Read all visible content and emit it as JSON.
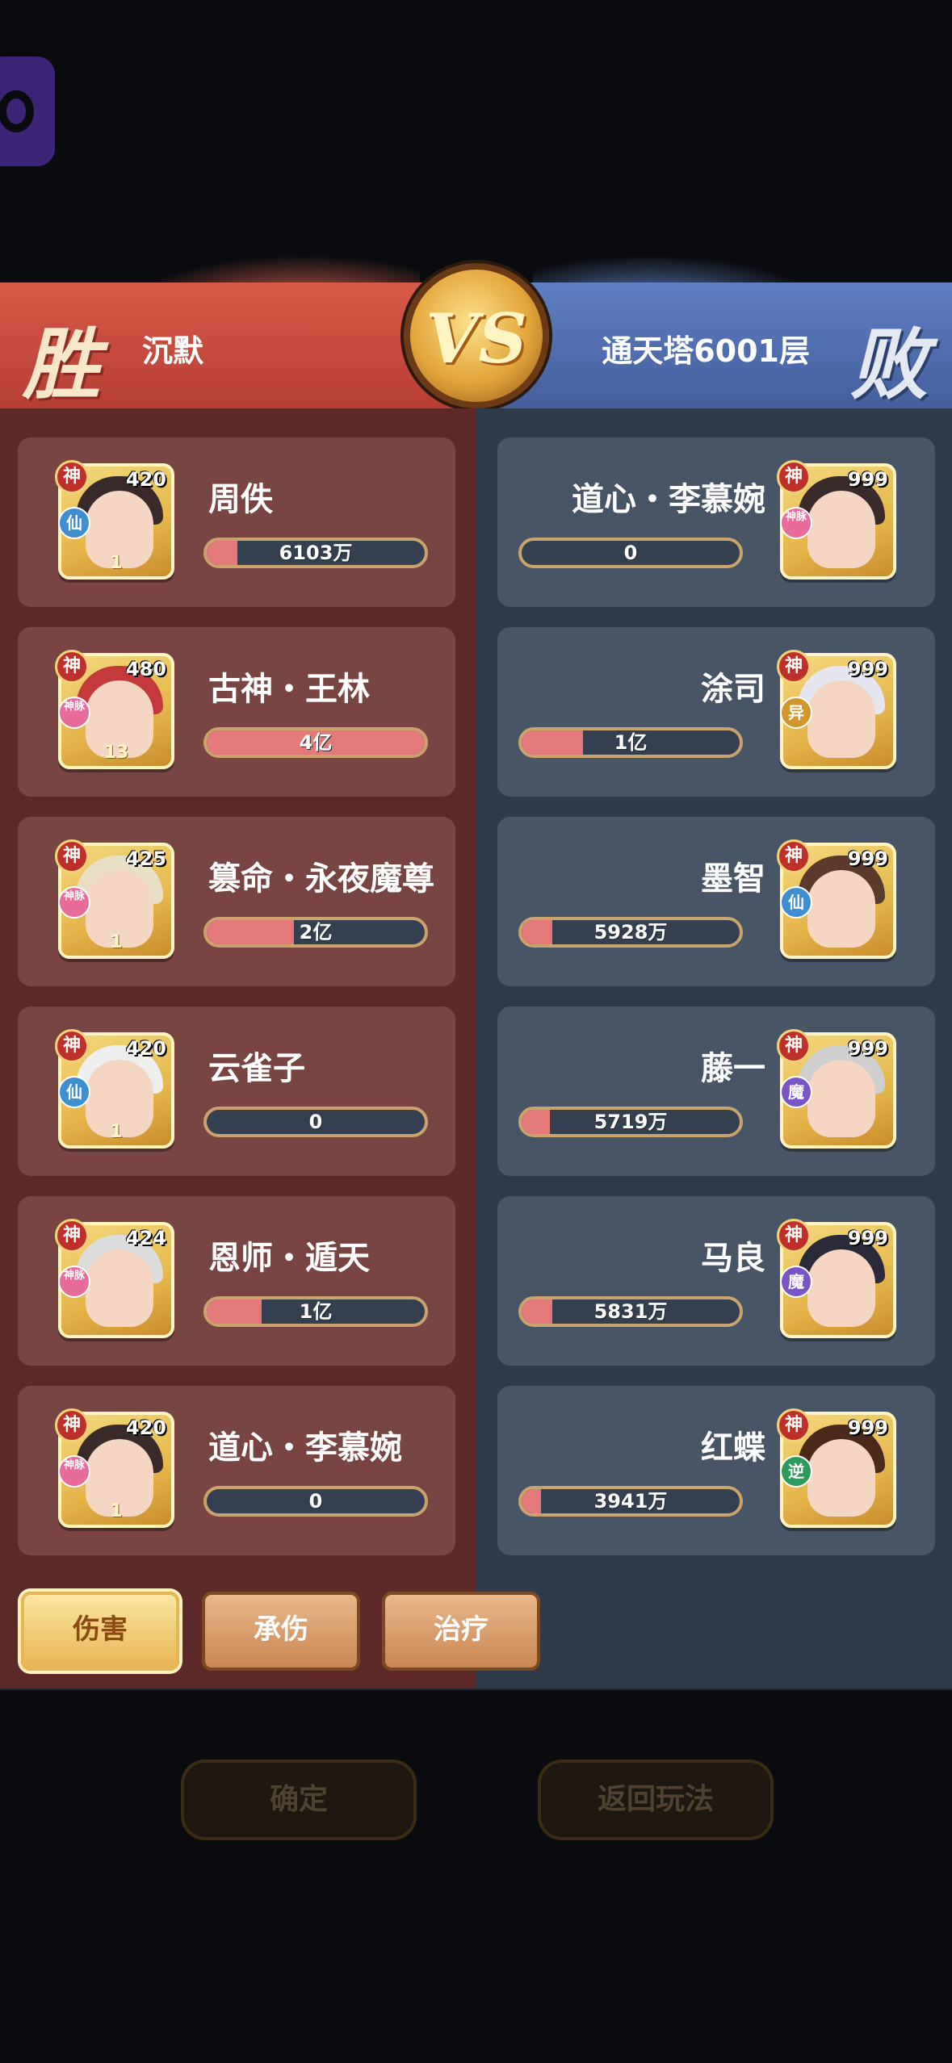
{
  "header": {
    "win_char": "胜",
    "lose_char": "败",
    "vs_label": "VS",
    "left_player": "沉默",
    "right_player": "通天塔6001层"
  },
  "left_team": [
    {
      "name": "周佚",
      "level": "420",
      "god": "神",
      "tag": "仙",
      "stars": "1",
      "value": "6103万",
      "fill": 0.14
    },
    {
      "name": "古神・王林",
      "level": "480",
      "god": "神",
      "tag": "神脉",
      "stars": "13",
      "value": "4亿",
      "fill": 1.0
    },
    {
      "name": "篡命・永夜魔尊",
      "level": "425",
      "god": "神",
      "tag": "神脉",
      "stars": "1",
      "value": "2亿",
      "fill": 0.4
    },
    {
      "name": "云雀子",
      "level": "420",
      "god": "神",
      "tag": "仙",
      "stars": "1",
      "value": "0",
      "fill": 0.0
    },
    {
      "name": "恩师・遁天",
      "level": "424",
      "god": "神",
      "tag": "神脉",
      "stars": "",
      "value": "1亿",
      "fill": 0.25
    },
    {
      "name": "道心・李慕婉",
      "level": "420",
      "god": "神",
      "tag": "神脉",
      "stars": "1",
      "value": "0",
      "fill": 0.0
    }
  ],
  "right_team": [
    {
      "name": "道心・李慕婉",
      "level": "999",
      "god": "神",
      "tag": "神脉",
      "value": "0",
      "fill": 0.0
    },
    {
      "name": "涂司",
      "level": "999",
      "god": "神",
      "tag": "异",
      "value": "1亿",
      "fill": 0.28
    },
    {
      "name": "墨智",
      "level": "999",
      "god": "神",
      "tag": "仙",
      "value": "5928万",
      "fill": 0.14
    },
    {
      "name": "藤一",
      "level": "999",
      "god": "神",
      "tag": "魔",
      "value": "5719万",
      "fill": 0.13
    },
    {
      "name": "马良",
      "level": "999",
      "god": "神",
      "tag": "魔",
      "value": "5831万",
      "fill": 0.14
    },
    {
      "name": "红蝶",
      "level": "999",
      "god": "神",
      "tag": "逆",
      "value": "3941万",
      "fill": 0.09
    }
  ],
  "tabs": [
    {
      "label": "伤害",
      "active": true
    },
    {
      "label": "承伤",
      "active": false
    },
    {
      "label": "治疗",
      "active": false
    }
  ],
  "footer": {
    "confirm_label": "确定",
    "back_label": "返回玩法"
  },
  "colors": {
    "bar_fill": "#e4797a",
    "left_bg": "#5e2a27",
    "right_bg": "#2f3b4b"
  }
}
